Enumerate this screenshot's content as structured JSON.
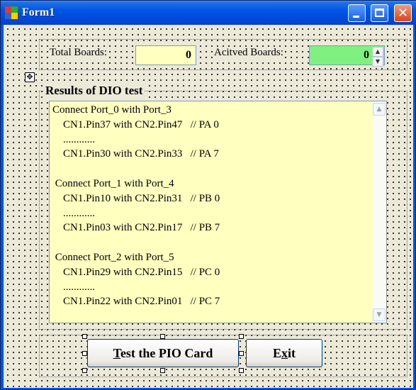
{
  "window": {
    "title": "Form1"
  },
  "titlebar_buttons": {
    "minimize": "minimize-icon",
    "maximize": "maximize-icon",
    "close": "close-icon"
  },
  "boards": {
    "total_label": "Total Boards:",
    "total_value": "0",
    "active_label": "Acitved Boards:",
    "active_value": "0",
    "total_bg": "#ffffc0",
    "active_bg": "#80f080"
  },
  "results": {
    "group_title": "Results of DIO test",
    "lines": [
      "Connect Port_0 with Port_3",
      "    CN1.Pin37 with CN2.Pin47   // PA 0",
      "    ............",
      "    CN1.Pin30 with CN2.Pin33   // PA 7",
      "",
      " Connect Port_1 with Port_4",
      "    CN1.Pin10 with CN2.Pin31   // PB 0",
      "    ............",
      "    CN1.Pin03 with CN2.Pin17   // PB 7",
      "",
      " Connect Port_2 with Port_5",
      "    CN1.Pin29 with CN2.Pin15   // PC 0",
      "    ............",
      "    CN1.Pin22 with CN2.Pin01   // PC 7"
    ]
  },
  "buttons": {
    "test": {
      "mnemonic": "T",
      "rest": "est the PIO Card"
    },
    "exit": {
      "pre": "E",
      "mnemonic": "x",
      "rest": "it"
    }
  }
}
